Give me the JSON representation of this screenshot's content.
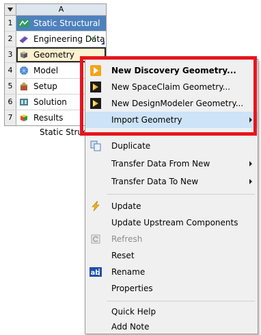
{
  "system_block": {
    "column_letter": "A",
    "rows": [
      {
        "num": "1",
        "label": "Static Structural",
        "icon": "static-structural-icon"
      },
      {
        "num": "2",
        "label": "Engineering Data",
        "icon": "engineering-data-icon"
      },
      {
        "num": "3",
        "label": "Geometry",
        "icon": "geometry-icon"
      },
      {
        "num": "4",
        "label": "Model",
        "icon": "model-icon"
      },
      {
        "num": "5",
        "label": "Setup",
        "icon": "setup-icon"
      },
      {
        "num": "6",
        "label": "Solution",
        "icon": "solution-icon"
      },
      {
        "num": "7",
        "label": "Results",
        "icon": "results-icon"
      }
    ],
    "caption": "Static Struc",
    "status_check": "✓"
  },
  "context_menu": {
    "new_discovery": "New Discovery Geometry...",
    "new_spaceclaim": "New SpaceClaim Geometry...",
    "new_designmodeler": "New DesignModeler Geometry...",
    "import_geometry": "Import Geometry",
    "duplicate": "Duplicate",
    "transfer_from_new": "Transfer Data From New",
    "transfer_to_new": "Transfer Data To New",
    "update": "Update",
    "update_upstream": "Update Upstream Components",
    "refresh": "Refresh",
    "reset": "Reset",
    "rename": "Rename",
    "properties": "Properties",
    "quick_help": "Quick Help",
    "add_note": "Add Note"
  },
  "colors": {
    "title_row": "#4f81bd",
    "highlight": "#e8141c",
    "menu_hover": "#cde3f7"
  }
}
